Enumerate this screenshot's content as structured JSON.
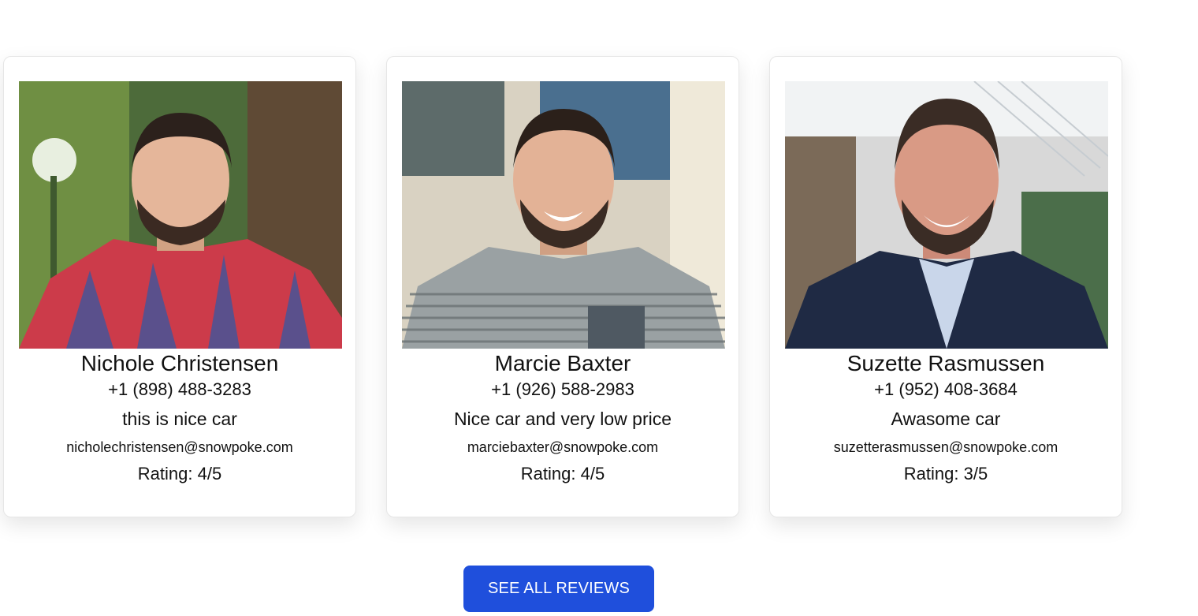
{
  "reviews": [
    {
      "name": "Nichole Christensen",
      "phone": "+1 (898) 488-3283",
      "review": "this is nice car",
      "email": "nicholechristensen@snowpoke.com",
      "rating": "Rating: 4/5"
    },
    {
      "name": "Marcie Baxter",
      "phone": "+1 (926) 588-2983",
      "review": "Nice car and very low price",
      "email": "marciebaxter@snowpoke.com",
      "rating": "Rating: 4/5"
    },
    {
      "name": "Suzette Rasmussen",
      "phone": "+1 (952) 408-3684",
      "review": "Awasome car",
      "email": "suzetterasmussen@snowpoke.com",
      "rating": "Rating: 3/5"
    }
  ],
  "cta": {
    "label": "SEE ALL REVIEWS"
  },
  "colors": {
    "accent": "#1f4fdc",
    "card_border": "#e6e6e6",
    "text": "#111111"
  }
}
